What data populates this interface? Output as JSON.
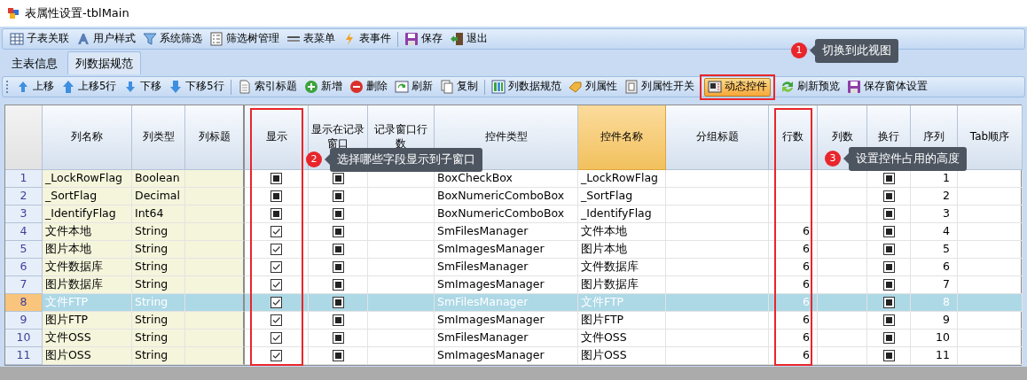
{
  "window": {
    "title": "表属性设置-tblMain"
  },
  "main_toolbar": [
    [
      {
        "label": "子表关联"
      },
      {
        "label": "用户样式"
      },
      {
        "label": "系统筛选"
      },
      {
        "label": "筛选树管理"
      },
      {
        "label": "表菜单"
      },
      {
        "label": "表事件"
      }
    ],
    [
      {
        "label": "保存"
      },
      {
        "label": "退出"
      }
    ]
  ],
  "tabs": [
    {
      "label": "主表信息",
      "selected": false
    },
    {
      "label": "列数据规范",
      "selected": true
    }
  ],
  "grid_toolbar": [
    [
      {
        "label": "上移",
        "selected": false,
        "annotated": false
      },
      {
        "label": "上移5行",
        "selected": false,
        "annotated": false
      },
      {
        "label": "下移",
        "selected": false,
        "annotated": false
      },
      {
        "label": "下移5行",
        "selected": false,
        "annotated": false
      }
    ],
    [
      {
        "label": "索引标题",
        "selected": false,
        "annotated": false
      },
      {
        "label": "新增",
        "selected": false,
        "annotated": false
      },
      {
        "label": "删除",
        "selected": false,
        "annotated": false
      },
      {
        "label": "刷新",
        "selected": false,
        "annotated": false
      },
      {
        "label": "复制",
        "selected": false,
        "annotated": false
      }
    ],
    [
      {
        "label": "列数据规范",
        "selected": false,
        "annotated": false
      },
      {
        "label": "列属性",
        "selected": false,
        "annotated": false
      },
      {
        "label": "列属性开关",
        "selected": false,
        "annotated": false
      },
      {
        "label": "动态控件",
        "selected": true,
        "annotated": true
      },
      {
        "label": "刷新预览",
        "selected": false,
        "annotated": false
      },
      {
        "label": "保存窗体设置",
        "selected": false,
        "annotated": false
      }
    ]
  ],
  "table": {
    "columns": [
      {
        "label": "列名称",
        "selected": false,
        "annotated": false
      },
      {
        "label": "列类型",
        "selected": false,
        "annotated": false
      },
      {
        "label": "列标题",
        "selected": false,
        "annotated": false
      },
      {
        "label": "显示",
        "selected": false,
        "annotated": true
      },
      {
        "label": "显示在记录窗口",
        "selected": false,
        "annotated": false
      },
      {
        "label": "记录窗口行数",
        "selected": false,
        "annotated": false
      },
      {
        "label": "控件类型",
        "selected": false,
        "annotated": false
      },
      {
        "label": "控件名称",
        "selected": true,
        "annotated": false
      },
      {
        "label": "分组标题",
        "selected": false,
        "annotated": false
      },
      {
        "label": "行数",
        "selected": false,
        "annotated": true
      },
      {
        "label": "列数",
        "selected": false,
        "annotated": false
      },
      {
        "label": "换行",
        "selected": false,
        "annotated": false
      },
      {
        "label": "序列",
        "selected": false,
        "annotated": false
      },
      {
        "label": "Tab顺序",
        "selected": false,
        "annotated": false
      }
    ],
    "rows": [
      {
        "number": "1",
        "name": "_LockRowFlag",
        "type": "Boolean",
        "show": false,
        "in_record": false,
        "control_type": "BoxCheckBox",
        "control_name": "_LockRowFlag",
        "wrap": false,
        "order": "1",
        "selected": false
      },
      {
        "number": "2",
        "name": "_SortFlag",
        "type": "Decimal",
        "show": false,
        "in_record": false,
        "control_type": "BoxNumericComboBox",
        "control_name": "_SortFlag",
        "wrap": false,
        "order": "2",
        "selected": false
      },
      {
        "number": "3",
        "name": "_IdentifyFlag",
        "type": "Int64",
        "show": false,
        "in_record": false,
        "control_type": "BoxNumericComboBox",
        "control_name": "_IdentifyFlag",
        "wrap": false,
        "order": "3",
        "selected": false
      },
      {
        "number": "4",
        "name": "文件本地",
        "type": "String",
        "show": true,
        "in_record": false,
        "control_type": "SmFilesManager",
        "control_name": "文件本地",
        "line_count": "6",
        "wrap": false,
        "order": "4",
        "selected": false
      },
      {
        "number": "5",
        "name": "图片本地",
        "type": "String",
        "show": true,
        "in_record": false,
        "control_type": "SmImagesManager",
        "control_name": "图片本地",
        "line_count": "6",
        "wrap": false,
        "order": "5",
        "selected": false
      },
      {
        "number": "6",
        "name": "文件数据库",
        "type": "String",
        "show": true,
        "in_record": false,
        "control_type": "SmFilesManager",
        "control_name": "文件数据库",
        "line_count": "6",
        "wrap": false,
        "order": "6",
        "selected": false
      },
      {
        "number": "7",
        "name": "图片数据库",
        "type": "String",
        "show": true,
        "in_record": false,
        "control_type": "SmImagesManager",
        "control_name": "图片数据库",
        "line_count": "6",
        "wrap": false,
        "order": "7",
        "selected": false
      },
      {
        "number": "8",
        "name": "文件FTP",
        "type": "String",
        "show": true,
        "in_record": false,
        "control_type": "SmFilesManager",
        "control_name": "文件FTP",
        "line_count": "6",
        "wrap": false,
        "order": "8",
        "selected": true
      },
      {
        "number": "9",
        "name": "图片FTP",
        "type": "String",
        "show": true,
        "in_record": false,
        "control_type": "SmImagesManager",
        "control_name": "图片FTP",
        "line_count": "6",
        "wrap": false,
        "order": "9",
        "selected": false
      },
      {
        "number": "10",
        "name": "文件OSS",
        "type": "String",
        "show": true,
        "in_record": false,
        "control_type": "SmFilesManager",
        "control_name": "文件OSS",
        "line_count": "6",
        "wrap": false,
        "order": "10",
        "selected": false
      },
      {
        "number": "11",
        "name": "图片OSS",
        "type": "String",
        "show": true,
        "in_record": false,
        "control_type": "SmImagesManager",
        "control_name": "图片OSS",
        "line_count": "6",
        "wrap": false,
        "order": "11",
        "selected": false
      }
    ]
  },
  "callouts": [
    {
      "number": "1",
      "text": "切换到此视图"
    },
    {
      "number": "2",
      "text": "选择哪些字段显示到子窗口"
    },
    {
      "number": "3",
      "text": "设置控件占用的高度"
    }
  ]
}
